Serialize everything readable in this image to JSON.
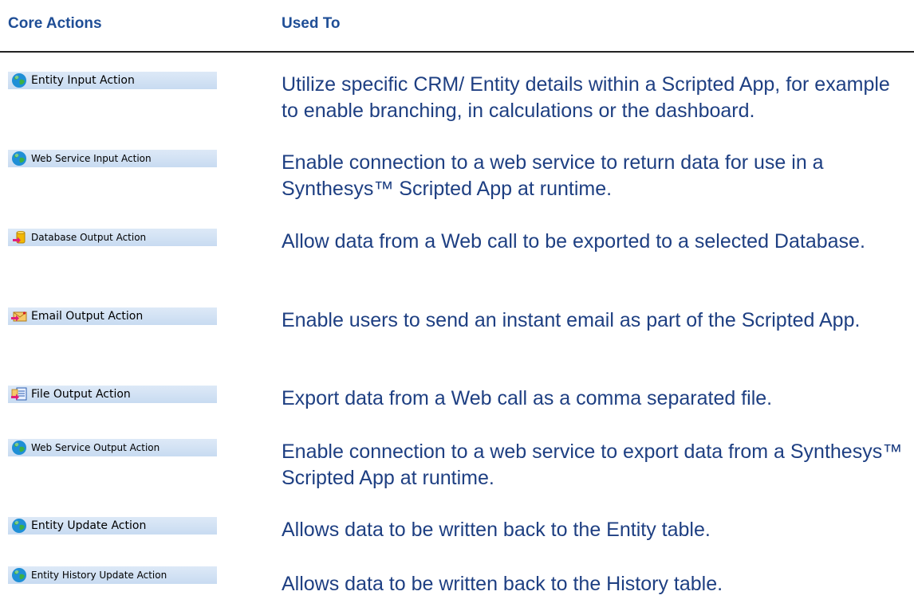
{
  "header": {
    "col_actions": "Core Actions",
    "col_used_to": "Used To"
  },
  "rows": [
    {
      "label": "Entity Input Action",
      "icon": "entity-globe-icon",
      "description": "Utilize specific CRM/ Entity details within a Scripted App, for example to enable branching, in calculations or the dashboard."
    },
    {
      "label": "Web Service Input Action",
      "icon": "web-service-globe-icon",
      "description": "Enable connection to a web service to return data for use in a Synthesys™ Scripted App at runtime."
    },
    {
      "label": "Database Output Action",
      "icon": "database-output-icon",
      "description": "Allow data from a Web call to be exported to a selected Database."
    },
    {
      "label": "Email Output Action",
      "icon": "email-output-icon",
      "description": "Enable users to send an instant email as part of the Scripted App."
    },
    {
      "label": "File Output Action",
      "icon": "file-output-icon",
      "description": "Export data from a Web call as a comma separated file."
    },
    {
      "label": "Web Service Output Action",
      "icon": "web-service-globe-icon",
      "description": "Enable connection to a web service to export data from a Synthesys™ Scripted App at runtime."
    },
    {
      "label": "Entity Update Action",
      "icon": "entity-globe-icon",
      "description": "Allows data to be written back to the Entity table."
    },
    {
      "label": "Entity History Update Action",
      "icon": "entity-globe-icon",
      "description": "Allows data to be written back to the History table."
    }
  ]
}
